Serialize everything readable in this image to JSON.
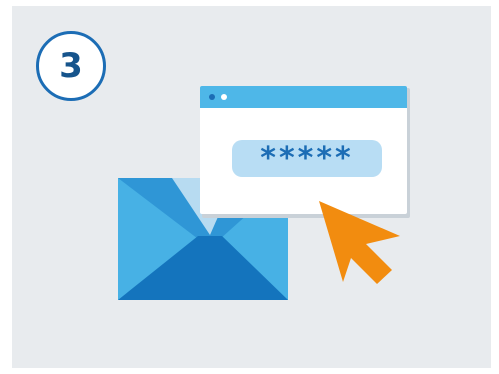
{
  "step": {
    "number": "3"
  },
  "password_field": {
    "masked_value": "*****"
  },
  "colors": {
    "panel_bg": "#e8ebee",
    "brand_blue": "#1c6db5",
    "dark_blue": "#16548c",
    "envelope_light": "#5bbde9",
    "envelope_mid": "#2f96d6",
    "envelope_dark": "#1474bd",
    "envelope_flap": "#b7dbf1",
    "window_titlebar": "#4eb7e8",
    "field_bg": "#b8ddf4",
    "cursor_orange": "#f28c0f"
  },
  "icons": [
    "envelope-icon",
    "browser-window-icon",
    "cursor-arrow-icon"
  ]
}
